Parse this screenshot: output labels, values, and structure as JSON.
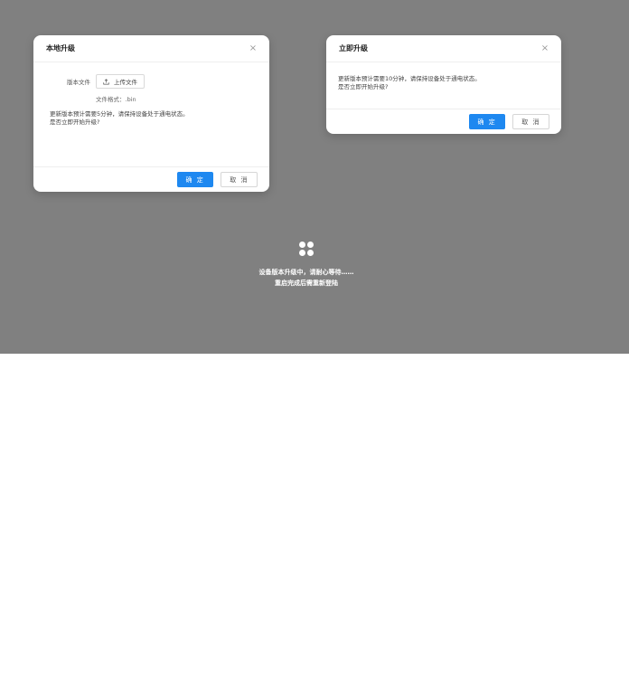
{
  "local_upgrade_dialog": {
    "title": "本地升级",
    "close_glyph": "×",
    "version_file_label": "版本文件",
    "upload_button_label": "上传文件",
    "file_format_hint": "文件格式：.bin",
    "message_line1": "更新版本预计需要5分钟，请保持设备处于通电状态。",
    "message_line2": "是否立即开始升级?",
    "confirm_label": "确 定",
    "cancel_label": "取 消"
  },
  "instant_upgrade_dialog": {
    "title": "立即升级",
    "close_glyph": "×",
    "message_line1": "更新版本预计需要10分钟，请保持设备处于通电状态。",
    "message_line2": "是否立即开始升级?",
    "confirm_label": "确 定",
    "cancel_label": "取 消"
  },
  "loading": {
    "icon": "loading-dots-icon",
    "line1": "设备版本升级中，请耐心等待……",
    "line2": "重启完成后需重新登陆"
  },
  "colors": {
    "overlay": "#808080",
    "primary": "#1e88f0"
  }
}
